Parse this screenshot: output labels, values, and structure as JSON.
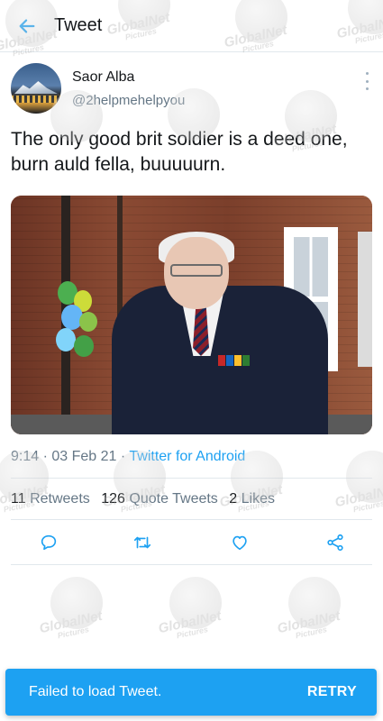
{
  "header": {
    "title": "Tweet",
    "back_icon": "arrow-left-icon"
  },
  "author": {
    "name": "Saor Alba",
    "handle": "@2helpmehelpyou"
  },
  "tweet": {
    "text": "The only good brit soldier is a deed one, burn auld fella, buuuuurn.",
    "time": "9:14",
    "date": "03 Feb 21",
    "source": "Twitter for Android"
  },
  "stats": {
    "retweets_count": "11",
    "retweets_label": "Retweets",
    "quotes_count": "126",
    "quotes_label": "Quote Tweets",
    "likes_count": "2",
    "likes_label": "Likes"
  },
  "snackbar": {
    "message": "Failed to load Tweet.",
    "action": "RETRY"
  },
  "watermark": {
    "brand": "GlobalNet",
    "sub": "Pictures"
  },
  "colors": {
    "accent": "#1da1f2",
    "secondary_text": "#657786",
    "primary_text": "#14171a"
  }
}
